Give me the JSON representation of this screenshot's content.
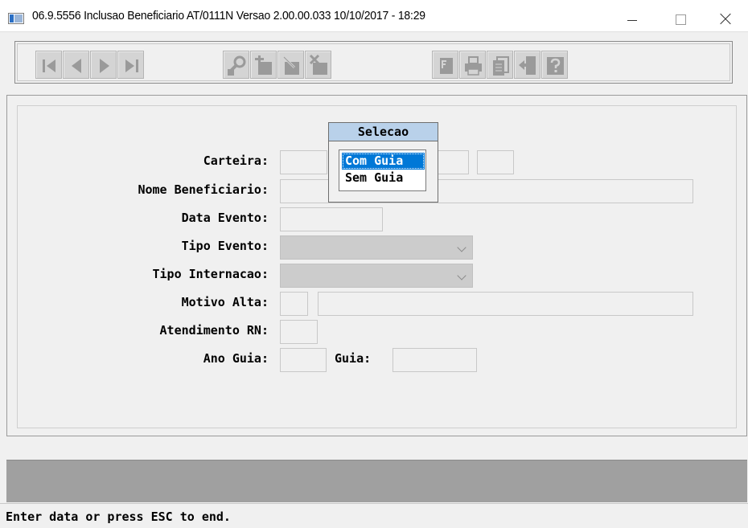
{
  "window": {
    "title": "06.9.5556  Inclusao  Beneficiario AT/0111N Versao 2.00.00.033 10/10/2017 - 18:29"
  },
  "toolbar": {
    "buttons": [
      {
        "name": "first-record-button",
        "icon": "first-record-icon"
      },
      {
        "name": "previous-record-button",
        "icon": "previous-record-icon"
      },
      {
        "name": "next-record-button",
        "icon": "next-record-icon"
      },
      {
        "name": "last-record-button",
        "icon": "last-record-icon"
      },
      {
        "name": "search-button",
        "icon": "key-search-icon"
      },
      {
        "name": "include-button",
        "icon": "add-record-icon"
      },
      {
        "name": "edit-button",
        "icon": "edit-record-icon"
      },
      {
        "name": "delete-button",
        "icon": "delete-record-icon"
      },
      {
        "name": "filter-button",
        "icon": "filter-icon"
      },
      {
        "name": "print-button",
        "icon": "printer-icon"
      },
      {
        "name": "copy-button",
        "icon": "copy-icon"
      },
      {
        "name": "exit-button",
        "icon": "exit-door-icon"
      },
      {
        "name": "help-button",
        "icon": "help-icon"
      }
    ]
  },
  "form": {
    "labels": {
      "carteira": "Carteira:",
      "nome_beneficiario": "Nome Beneficiario:",
      "data_evento": "Data Evento:",
      "tipo_evento": "Tipo Evento:",
      "tipo_internacao": "Tipo Internacao:",
      "motivo_alta": "Motivo Alta:",
      "atendimento_rn": "Atendimento RN:",
      "ano_guia": "Ano Guia:",
      "guia": "Guia:"
    },
    "values": {
      "carteira_1": "",
      "carteira_2": "",
      "carteira_3": "",
      "carteira_4": "",
      "nome_beneficiario": "",
      "data_evento": "",
      "tipo_evento": "",
      "tipo_internacao": "",
      "motivo_alta_code": "",
      "motivo_alta_desc": "",
      "atendimento_rn": "",
      "ano_guia": "",
      "guia": ""
    }
  },
  "selection_popup": {
    "title": "Selecao",
    "options": [
      "Com Guia",
      "Sem Guia"
    ],
    "selected": "Com Guia"
  },
  "status_bar": {
    "message": "Enter data or press ESC to end."
  },
  "colors": {
    "popup_title_bg": "#b9d1ea",
    "selection_highlight": "#0078d7",
    "disabled_field": "#cccccc",
    "gray_band": "#a0a0a0"
  }
}
